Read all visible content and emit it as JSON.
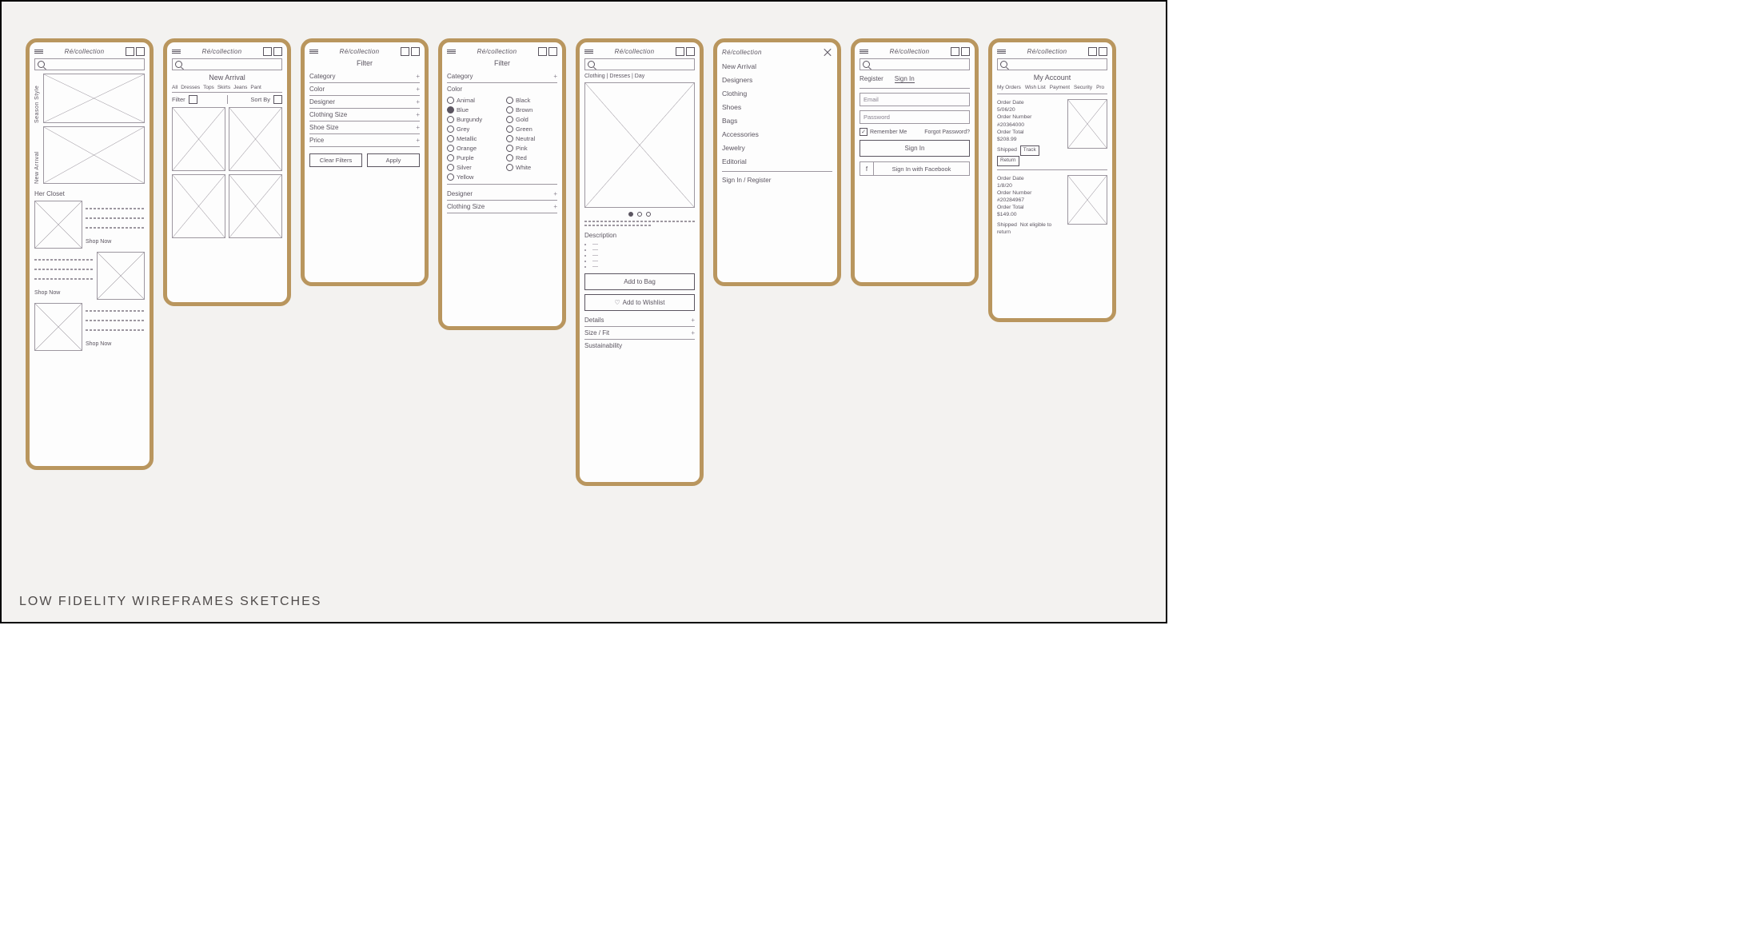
{
  "brand": "Ré/collection",
  "caption": "LOW  FIDELITY  WIREFRAMES   SKETCHES",
  "frame_color": "#b9965e",
  "screens": [
    {
      "id": "home",
      "sections": [
        {
          "label": "Season Style"
        },
        {
          "label": "New Arrival"
        },
        {
          "label": "Her Closet",
          "cta": "Shop Now"
        },
        {
          "cta": "Shop Now"
        },
        {
          "cta": "Shop Now"
        }
      ]
    },
    {
      "id": "category",
      "title": "New Arrival",
      "tabs": [
        "All",
        "Dresses",
        "Tops",
        "Skirts",
        "Jeans",
        "Pant"
      ],
      "filter_label": "Filter",
      "sort_label": "Sort By"
    },
    {
      "id": "filter-collapsed",
      "title": "Filter",
      "options": [
        "Category",
        "Color",
        "Designer",
        "Clothing Size",
        "Shoe Size",
        "Price"
      ],
      "clear": "Clear Filters",
      "apply": "Apply"
    },
    {
      "id": "filter-expanded",
      "title": "Filter",
      "options_top": [
        "Category",
        "Color"
      ],
      "colors_left": [
        "Animal",
        "Blue",
        "Burgundy",
        "Grey",
        "Metallic",
        "Orange",
        "Purple",
        "Silver",
        "Yellow"
      ],
      "colors_right": [
        "Black",
        "Brown",
        "Gold",
        "Green",
        "Neutral",
        "Pink",
        "Red",
        "White"
      ],
      "selected_color": "Blue",
      "options_bottom": [
        "Designer",
        "Clothing Size"
      ]
    },
    {
      "id": "pdp",
      "breadcrumb": "Clothing | Dresses | Day",
      "desc_title": "Description",
      "add_bag": "Add to Bag",
      "add_wish": "Add to Wishlist",
      "accordions": [
        "Details",
        "Size / Fit",
        "Sustainability"
      ]
    },
    {
      "id": "nav",
      "items": [
        "New Arrival",
        "Designers",
        "Clothing",
        "Shoes",
        "Bags",
        "Accessories",
        "Jewelry",
        "Editorial"
      ],
      "auth": "Sign In / Register"
    },
    {
      "id": "signin",
      "tabs": {
        "register": "Register",
        "signin": "Sign In"
      },
      "email": "Email",
      "password": "Password",
      "remember": "Remember Me",
      "forgot": "Forgot Password?",
      "signin_btn": "Sign In",
      "fb": "Sign In with Facebook"
    },
    {
      "id": "account",
      "title": "My Account",
      "tabs": [
        "My Orders",
        "Wish List",
        "Payment",
        "Security",
        "Pro"
      ],
      "orders": [
        {
          "date_label": "Order Date",
          "date": "5/06/20",
          "num_label": "Order Number",
          "num": "#20364000",
          "total_label": "Order Total",
          "total": "$208.99",
          "status": "Shipped",
          "track": "Track",
          "return": "Return"
        },
        {
          "date_label": "Order Date",
          "date": "1/8/20",
          "num_label": "Order Number",
          "num": "#20284967",
          "total_label": "Order Total",
          "total": "$149.00",
          "status": "Shipped",
          "note": "Not eligible to return"
        }
      ]
    }
  ]
}
